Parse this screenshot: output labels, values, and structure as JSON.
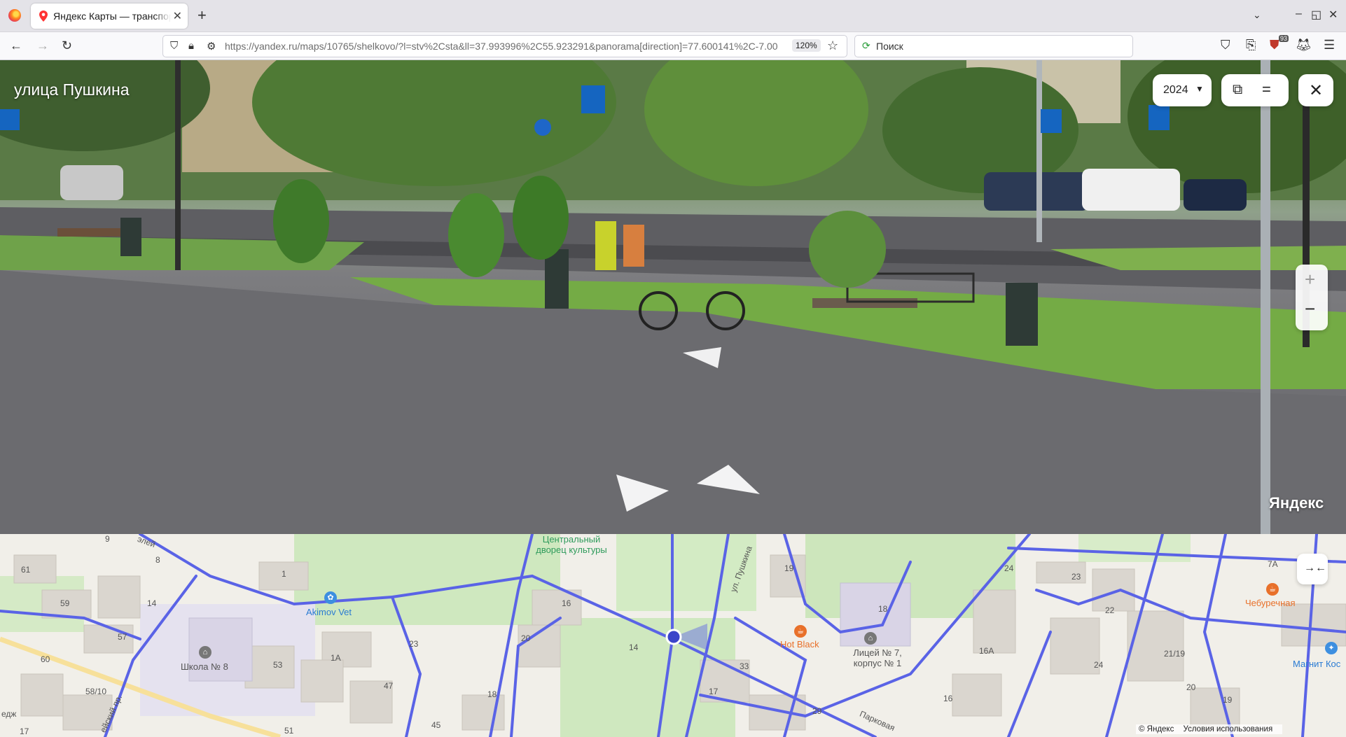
{
  "browser": {
    "tab_title": "Яндекс Карты — транспорт, навигация, поиск мест",
    "tab_close": "✕",
    "new_tab": "+",
    "tab_list": "⌄",
    "window_buttons": [
      "‒",
      "◱",
      "✕"
    ],
    "nav_back": "←",
    "nav_forward": "→",
    "nav_reload": "↻",
    "url": "https://yandex.ru/maps/10765/shelkovo/?l=stv%2Csta&ll=37.993996%2C55.923291&panorama[direction]=77.600141%2C-7.00",
    "zoom": "120%",
    "bookmark_star": "☆",
    "search_placeholder": "Поиск",
    "extensions_badge": "93",
    "menu": "☰"
  },
  "panorama": {
    "street_name": "улица Пушкина",
    "year": "2024",
    "year_caret": "▼",
    "open_external": "⧉",
    "layers_icon": "=",
    "close": "✕",
    "zoom_in": "+",
    "zoom_out": "−",
    "watermark": "Яндекс"
  },
  "minimap": {
    "collapse": "→←",
    "poi": [
      {
        "name": "Центральный дворец культуры",
        "color": "#2f9b5b"
      },
      {
        "name": "Akimov Vet",
        "color": "#2a7bd3"
      },
      {
        "name": "Hot Black",
        "color": "#e8702a"
      },
      {
        "name": "Лицей № 7, корпус № 1",
        "color": "#555"
      },
      {
        "name": "Школа № 8",
        "color": "#555"
      },
      {
        "name": "Чебуречная",
        "color": "#e8702a"
      },
      {
        "name": "Магнит Кос",
        "color": "#2a7bd3"
      }
    ],
    "streets": [
      "ул. Пушкина",
      "Парковая",
      "ейский пр.",
      "элей",
      "едж"
    ],
    "house_numbers": [
      "9",
      "8",
      "61",
      "1",
      "59",
      "14",
      "57",
      "16",
      "20",
      "23",
      "1А",
      "53",
      "14",
      "60",
      "58/10",
      "47",
      "18",
      "45",
      "17",
      "51",
      "33",
      "17",
      "29",
      "19",
      "18",
      "16",
      "16А",
      "24",
      "23",
      "22",
      "24",
      "21/19",
      "20",
      "19",
      "7А"
    ],
    "footer_copyright": "© Яндекс",
    "footer_terms": "Условия использования"
  }
}
